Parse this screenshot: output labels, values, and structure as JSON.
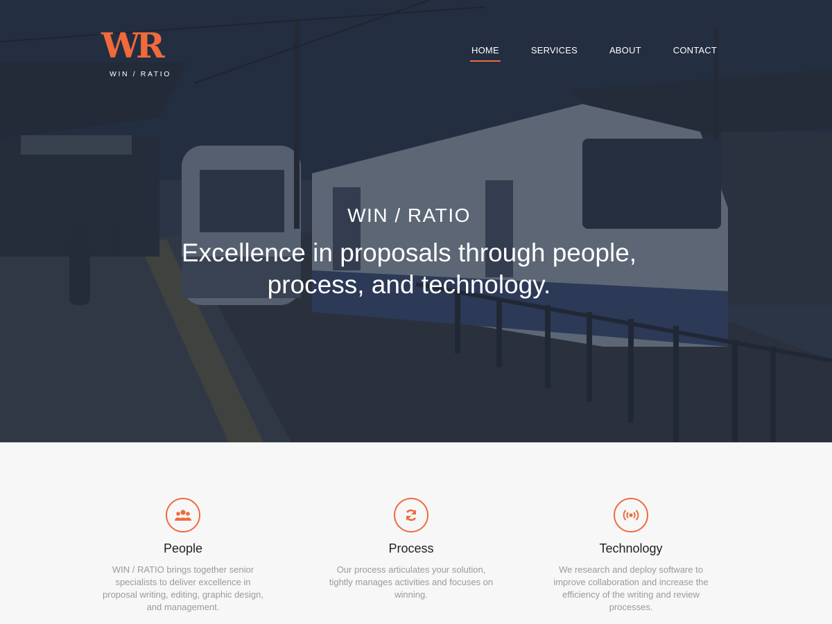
{
  "brand": {
    "logo_mark": "WR",
    "logo_text": "WIN / RATIO"
  },
  "nav": {
    "items": [
      {
        "label": "HOME",
        "active": true
      },
      {
        "label": "SERVICES",
        "active": false
      },
      {
        "label": "ABOUT",
        "active": false
      },
      {
        "label": "CONTACT",
        "active": false
      }
    ]
  },
  "hero": {
    "eyebrow": "WIN / RATIO",
    "headline_line1": "Excellence in proposals through people,",
    "headline_line2": "process, and technology."
  },
  "features": [
    {
      "icon": "people-icon",
      "title": "People",
      "body": "WIN / RATIO brings together senior specialists to deliver excellence in proposal writing, editing, graphic design, and management."
    },
    {
      "icon": "refresh-icon",
      "title": "Process",
      "body": "Our process articulates your solution, tightly manages activities and focuses on winning."
    },
    {
      "icon": "broadcast-icon",
      "title": "Technology",
      "body": "We research and deploy software to improve collaboration and increase the efficiency of the writing and review processes."
    }
  ],
  "colors": {
    "accent": "#f06a3c",
    "hero_overlay": "#1e283a",
    "section_bg": "#f7f7f7",
    "body_text": "#9a9a9a"
  }
}
